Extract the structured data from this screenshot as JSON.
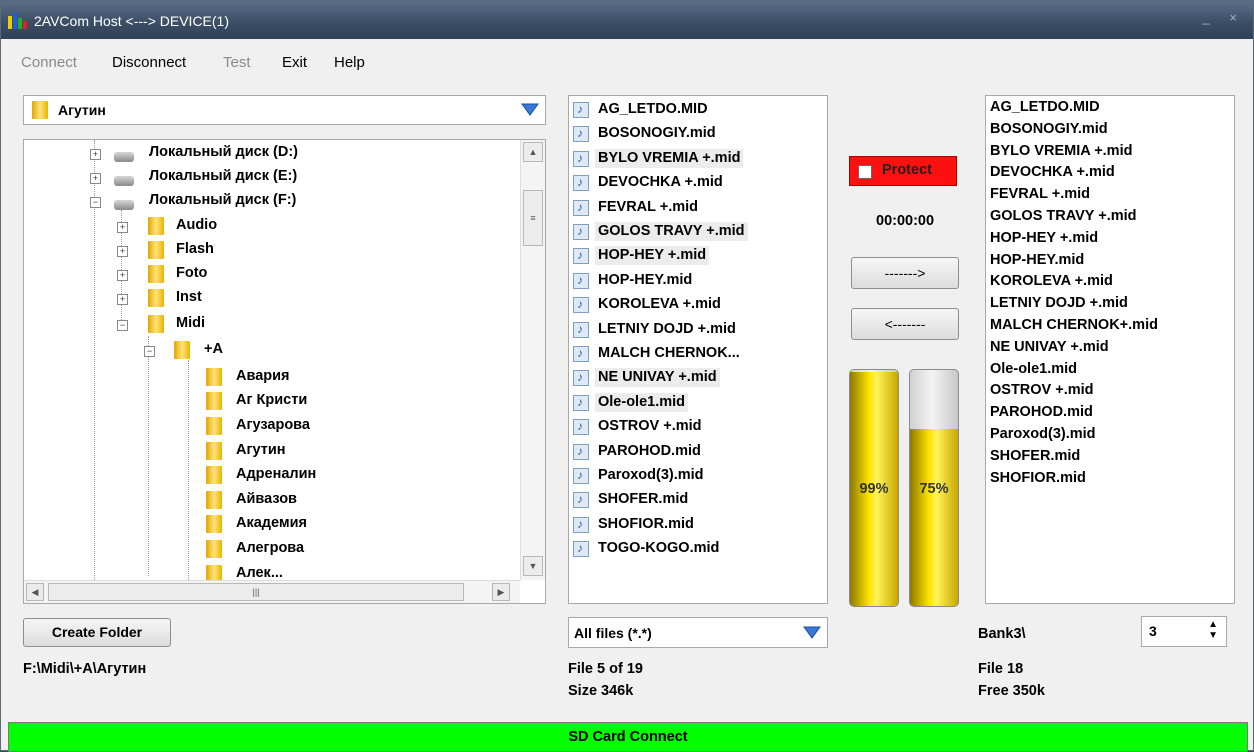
{
  "window": {
    "title": "2AVCom Host <---> DEVICE(1)",
    "controls": "_ ×"
  },
  "menu": [
    {
      "label": "Connect",
      "enabled": false
    },
    {
      "label": "Disconnect",
      "enabled": true
    },
    {
      "label": "Test",
      "enabled": false
    },
    {
      "label": "Exit",
      "enabled": true
    },
    {
      "label": "Help",
      "enabled": true
    }
  ],
  "left": {
    "folder_combo": "Агутин",
    "tree": [
      {
        "label": "Локальный диск (D:)",
        "type": "drive",
        "expander": "+"
      },
      {
        "label": "Локальный диск (E:)",
        "type": "drive",
        "expander": "+"
      },
      {
        "label": "Локальный диск (F:)",
        "type": "drive",
        "expander": "−"
      },
      {
        "label": "Audio",
        "type": "folder",
        "expander": "+"
      },
      {
        "label": "Flash",
        "type": "folder",
        "expander": "+"
      },
      {
        "label": "Foto",
        "type": "folder",
        "expander": "+"
      },
      {
        "label": "Inst",
        "type": "folder",
        "expander": "+"
      },
      {
        "label": "Midi",
        "type": "folder",
        "expander": "−"
      },
      {
        "label": "+A",
        "type": "folder",
        "expander": "−"
      },
      {
        "label": "Авария",
        "type": "folder"
      },
      {
        "label": "Аг Кристи",
        "type": "folder"
      },
      {
        "label": "Агузарова",
        "type": "folder"
      },
      {
        "label": "Агутин",
        "type": "folder"
      },
      {
        "label": "Адреналин",
        "type": "folder"
      },
      {
        "label": "Айвазов",
        "type": "folder"
      },
      {
        "label": "Академия",
        "type": "folder"
      },
      {
        "label": "Алегрова",
        "type": "folder"
      },
      {
        "label": "Алек...",
        "type": "folder"
      }
    ],
    "create_folder_label": "Create Folder",
    "path": "F:\\Midi\\+A\\Агутин"
  },
  "files": {
    "items": [
      "AG_LETDO.MID",
      "BOSONOGIY.mid",
      "BYLO VREMIA +.mid",
      "DEVOCHKA +.mid",
      "FEVRAL +.mid",
      "GOLOS TRAVY +.mid",
      "HOP-HEY +.mid",
      "HOP-HEY.mid",
      "KOROLEVA +.mid",
      "LETNIY DOJD +.mid",
      "MALCH CHERNOK...",
      "NE UNIVAY +.mid",
      "Ole-ole1.mid",
      "OSTROV +.mid",
      "PAROHOD.mid",
      "Paroxod(3).mid",
      "SHOFER.mid",
      "SHOFIOR.mid",
      "TOGO-KOGO.mid"
    ],
    "highlighted": [
      2,
      5,
      6,
      11,
      12
    ],
    "filter": "All files (*.*)",
    "status_line1": "File 5 of 19",
    "status_line2": "Size 346k"
  },
  "middle": {
    "protect_label": "Protect",
    "time": "00:00:00",
    "send_label": "------->",
    "receive_label": "<-------",
    "gauge_left": {
      "value": 99,
      "label": "99%"
    },
    "gauge_right": {
      "value": 75,
      "label": "75%"
    }
  },
  "bank": {
    "items": [
      "AG_LETDO.MID",
      "BOSONOGIY.mid",
      "BYLO VREMIA +.mid",
      "DEVOCHKA +.mid",
      "FEVRAL +.mid",
      "GOLOS TRAVY +.mid",
      "HOP-HEY +.mid",
      "HOP-HEY.mid",
      "KOROLEVA +.mid",
      "LETNIY DOJD +.mid",
      "MALCH CHERNOK+.mid",
      "NE UNIVAY +.mid",
      "Ole-ole1.mid",
      "OSTROV +.mid",
      "PAROHOD.mid",
      "Paroxod(3).mid",
      "SHOFER.mid",
      "SHOFIOR.mid"
    ],
    "path": "Bank3\\",
    "bank_number": "3",
    "status_line1": "File 18",
    "status_line2": "Free 350k"
  },
  "statusbar": "SD Card Connect"
}
